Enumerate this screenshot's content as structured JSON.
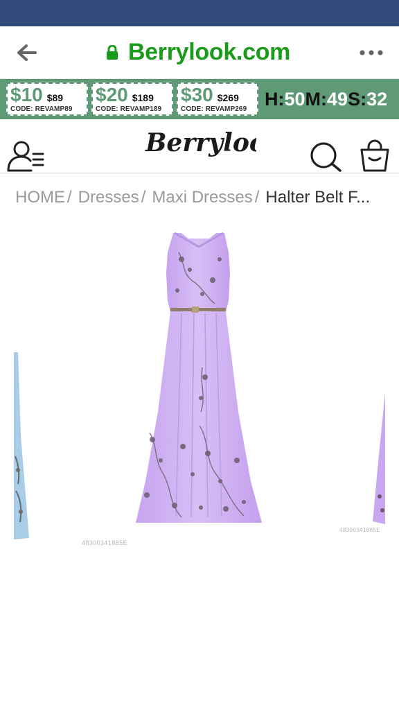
{
  "browser": {
    "url": "Berrylook.com"
  },
  "promo": {
    "coupons": [
      {
        "amount": "$10",
        "price": "$89",
        "code": "CODE: REVAMP89"
      },
      {
        "amount": "$20",
        "price": "$189",
        "code": "CODE: REVAMP189"
      },
      {
        "amount": "$30",
        "price": "$269",
        "code": "CODE: REVAMP269"
      }
    ],
    "timer": {
      "h_label": "H:",
      "h": "50",
      "m_label": "M:",
      "m": "49",
      "s_label": "S:",
      "s": "32"
    }
  },
  "header": {
    "logo_text": "Berrylook"
  },
  "breadcrumb": {
    "items": [
      "HOME",
      "Dresses",
      "Maxi Dresses"
    ],
    "current": "Halter Belt F..."
  },
  "gallery": {
    "main_sku": "48300341885E",
    "right_sku": "48300341885E"
  },
  "colors": {
    "status_bar": "#334b7c",
    "url_green": "#1b9b1b",
    "promo_green": "#5f9a77",
    "dress_lavender": "#c9a8f1"
  }
}
